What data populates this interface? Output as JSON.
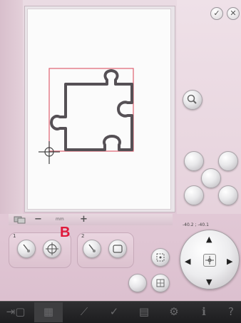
{
  "callout": {
    "label": "B"
  },
  "zoom": {
    "minus": "−",
    "value": "mm",
    "plus": "+"
  },
  "coordinates": {
    "readout": "-40.2 ; -40.1"
  },
  "groups": [
    {
      "number": "1"
    },
    {
      "number": "2"
    }
  ],
  "icons": {
    "ok": "checkmark-icon",
    "close": "close-icon",
    "zoom_to_fit": "magnifier-icon",
    "pan": "pan-icon",
    "dpad_up": "arrow-up-icon",
    "dpad_down": "arrow-down-icon",
    "dpad_left": "arrow-left-icon",
    "dpad_right": "arrow-right-icon"
  },
  "colors": {
    "accent_callout": "#e0183a",
    "selection_frame": "#e06070",
    "puzzle_outline": "#555055"
  }
}
